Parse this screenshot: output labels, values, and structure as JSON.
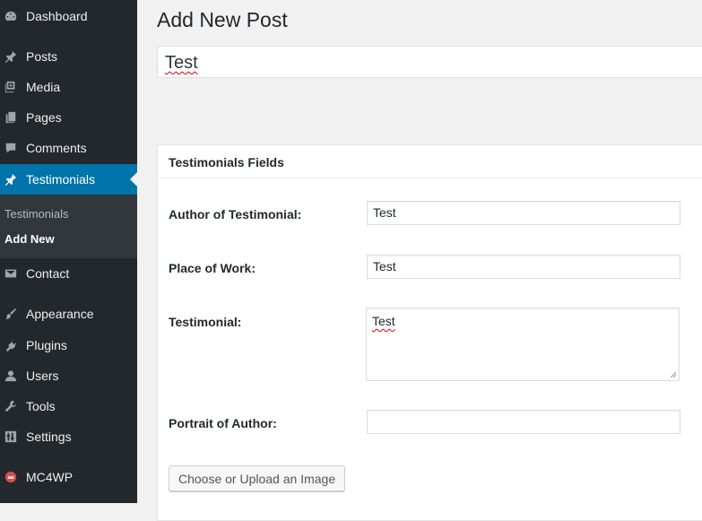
{
  "sidebar": {
    "items": [
      {
        "label": "Dashboard",
        "icon": "dashboard-icon"
      },
      {
        "label": "Posts",
        "icon": "pin-icon"
      },
      {
        "label": "Media",
        "icon": "media-icon"
      },
      {
        "label": "Pages",
        "icon": "pages-icon"
      },
      {
        "label": "Comments",
        "icon": "comment-icon"
      },
      {
        "label": "Testimonials",
        "icon": "pin-icon"
      },
      {
        "label": "Contact",
        "icon": "envelope-icon"
      },
      {
        "label": "Appearance",
        "icon": "paintbrush-icon"
      },
      {
        "label": "Plugins",
        "icon": "plug-icon"
      },
      {
        "label": "Users",
        "icon": "user-icon"
      },
      {
        "label": "Tools",
        "icon": "wrench-icon"
      },
      {
        "label": "Settings",
        "icon": "sliders-icon"
      },
      {
        "label": "MC4WP",
        "icon": "mc4wp-icon"
      }
    ],
    "submenu": [
      {
        "label": "Testimonials"
      },
      {
        "label": "Add New"
      }
    ],
    "colors": {
      "bg": "#23282d",
      "active": "#0073aa"
    }
  },
  "page": {
    "title": "Add New Post",
    "post_title_value": "Test"
  },
  "metabox": {
    "title": "Testimonials Fields",
    "fields": [
      {
        "label": "Author of Testimonial:",
        "value": "Test"
      },
      {
        "label": "Place of Work:",
        "value": "Test"
      },
      {
        "label": "Testimonial:",
        "value": "Test"
      },
      {
        "label": "Portrait of Author:",
        "value": ""
      }
    ],
    "upload_button": "Choose or Upload an Image"
  }
}
